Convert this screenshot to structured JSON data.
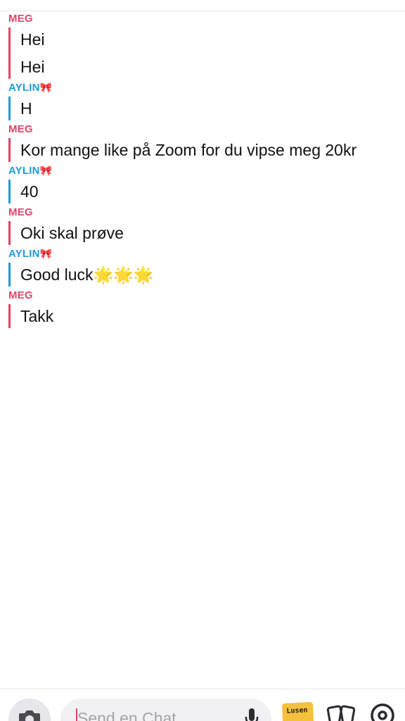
{
  "messages": [
    {
      "sender": "MEG",
      "bow": "",
      "role": "me",
      "texts": [
        "Hei",
        "Hei"
      ]
    },
    {
      "sender": "AYLIN",
      "bow": "🎀",
      "role": "them",
      "texts": [
        "H"
      ]
    },
    {
      "sender": "MEG",
      "bow": "",
      "role": "me",
      "texts": [
        "Kor mange like på Zoom for du vipse meg 20kr"
      ]
    },
    {
      "sender": "AYLIN",
      "bow": "🎀",
      "role": "them",
      "texts": [
        "40"
      ]
    },
    {
      "sender": "MEG",
      "bow": "",
      "role": "me",
      "texts": [
        "Oki skal prøve"
      ]
    },
    {
      "sender": "AYLIN",
      "bow": "🎀",
      "role": "them",
      "texts": [
        "Good luck🌟🌟🌟"
      ]
    },
    {
      "sender": "MEG",
      "bow": "",
      "role": "me",
      "texts": [
        "Takk"
      ]
    }
  ],
  "input": {
    "placeholder": "Send en Chat"
  },
  "sticker": {
    "text": "Lusen"
  },
  "colors": {
    "me": "#e04469",
    "them": "#1f9ad6"
  },
  "icons": [
    "camera-icon",
    "microphone-icon",
    "sticker-icon",
    "cards-icon",
    "location-pin-icon"
  ]
}
